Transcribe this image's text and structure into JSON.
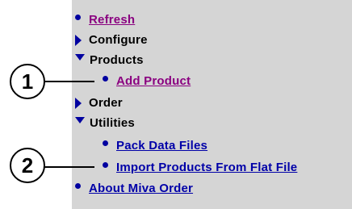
{
  "menu": {
    "refresh": "Refresh",
    "configure": "Configure",
    "products": "Products",
    "add_product": "Add Product",
    "order": "Order",
    "utilities": "Utilities",
    "pack_data_files": "Pack Data Files",
    "import_products": "Import Products From Flat File",
    "about": "About Miva Order"
  },
  "callouts": {
    "first": "1",
    "second": "2"
  },
  "colors": {
    "panel_bg": "#d5d5d5",
    "link": "#0000a8",
    "visited_link": "#8a0080",
    "icon": "#0000a0"
  }
}
